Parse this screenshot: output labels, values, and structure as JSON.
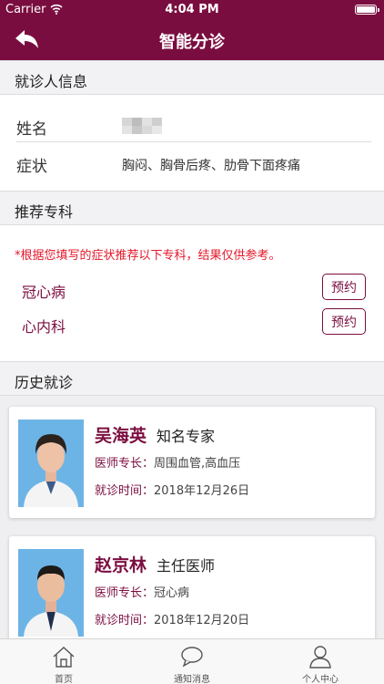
{
  "status_bar": {
    "carrier": "Carrier",
    "time": "4:04 PM"
  },
  "navbar": {
    "title": "智能分诊",
    "back_icon": "back-arrow-icon"
  },
  "patient_info": {
    "header": "就诊人信息",
    "name_label": "姓名",
    "symptom_label": "症状",
    "symptom_value": "胸闷、胸骨后疼、肋骨下面疼痛"
  },
  "recommended": {
    "header": "推荐专科",
    "notice": "*根据您填写的症状推荐以下专科，结果仅供参考。",
    "departments": [
      {
        "name": "冠心病",
        "button": "预约"
      },
      {
        "name": "心内科",
        "button": "预约"
      }
    ]
  },
  "history": {
    "header": "历史就诊",
    "records": [
      {
        "name": "吴海英",
        "title": "知名专家",
        "specialty_label": "医师专长：",
        "specialty": "周围血管,高血压",
        "date_label": "就诊时间：",
        "date": "2018年12月26日"
      },
      {
        "name": "赵京林",
        "title": "主任医师",
        "specialty_label": "医师专长：",
        "specialty": "冠心病",
        "date_label": "就诊时间：",
        "date": "2018年12月20日"
      }
    ]
  },
  "tabbar": {
    "items": [
      {
        "label": "首页",
        "icon": "home-icon"
      },
      {
        "label": "通知消息",
        "icon": "chat-bubble-icon"
      },
      {
        "label": "个人中心",
        "icon": "person-icon"
      }
    ]
  },
  "colors": {
    "brand": "#7a0d3f",
    "notice": "#e4172a",
    "background": "#efeff2"
  }
}
